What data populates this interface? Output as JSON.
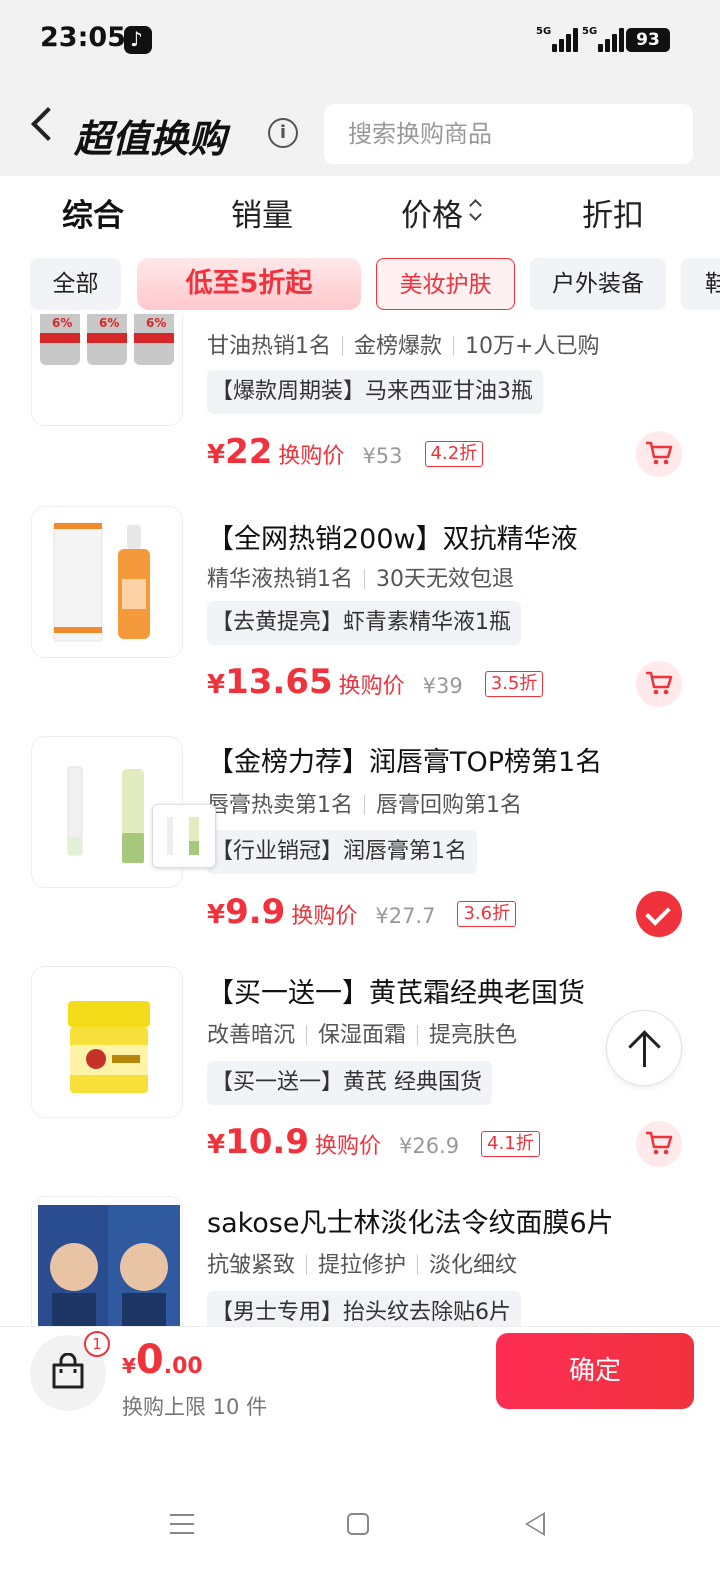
{
  "status_bar": {
    "time": "23:05",
    "net1": "5G",
    "net2": "5G",
    "battery": "93"
  },
  "header": {
    "title": "超值换购",
    "search_placeholder": "搜索换购商品"
  },
  "sort_tabs": [
    {
      "label": "综合",
      "active": true
    },
    {
      "label": "销量",
      "active": false
    },
    {
      "label": "价格",
      "active": false
    },
    {
      "label": "折扣",
      "active": false
    }
  ],
  "filter_chips": [
    {
      "label": "全部"
    },
    {
      "label": "低至5折起"
    },
    {
      "label": "美妆护肤",
      "selected": true
    },
    {
      "label": "户外装备"
    },
    {
      "label": "鞋"
    }
  ],
  "products": [
    {
      "title": "",
      "tags": [
        "甘油热销1名",
        "金榜爆款",
        "10万+人已购"
      ],
      "label": "【爆款周期装】马来西亚甘油3瓶",
      "price_symbol": "¥",
      "price": "22",
      "price_note": "换购价",
      "original_price": "¥53",
      "discount": "4.2折",
      "action": "cart"
    },
    {
      "title": "【全网热销200w】双抗精华液",
      "tags": [
        "精华液热销1名",
        "30天无效包退"
      ],
      "label": "【去黄提亮】虾青素精华液1瓶",
      "price_symbol": "¥",
      "price": "13.65",
      "price_note": "换购价",
      "original_price": "¥39",
      "discount": "3.5折",
      "action": "cart"
    },
    {
      "title": "【金榜力荐】润唇膏TOP榜第1名",
      "tags": [
        "唇膏热卖第1名",
        "唇膏回购第1名"
      ],
      "label": "【行业销冠】润唇膏第1名",
      "price_symbol": "¥",
      "price": "9.9",
      "price_note": "换购价",
      "original_price": "¥27.7",
      "discount": "3.6折",
      "action": "selected"
    },
    {
      "title": "【买一送一】黄芪霜经典老国货",
      "tags": [
        "改善暗沉",
        "保湿面霜",
        "提亮肤色"
      ],
      "label": "【买一送一】黄芪 经典国货",
      "price_symbol": "¥",
      "price": "10.9",
      "price_note": "换购价",
      "original_price": "¥26.9",
      "discount": "4.1折",
      "action": "cart"
    },
    {
      "title": "sakose凡士林淡化法令纹面膜6片",
      "tags": [
        "抗皱紧致",
        "提拉修护",
        "淡化细纹"
      ],
      "label": "【男士专用】抬头纹去除贴6片"
    }
  ],
  "bottom_bar": {
    "badge_count": "1",
    "currency": "¥",
    "total_int": "0",
    "total_dec": ".00",
    "limit_text": "换购上限 10 件",
    "confirm_label": "确定"
  },
  "colors": {
    "accent": "#f0323c",
    "accent_light": "#ffe9ea",
    "header_bg": "#f2f2f2"
  },
  "icons": [
    "back-arrow-icon",
    "info-icon",
    "sort-arrows-icon",
    "cart-icon",
    "check-icon",
    "arrow-up-icon",
    "shopping-bag-icon"
  ]
}
